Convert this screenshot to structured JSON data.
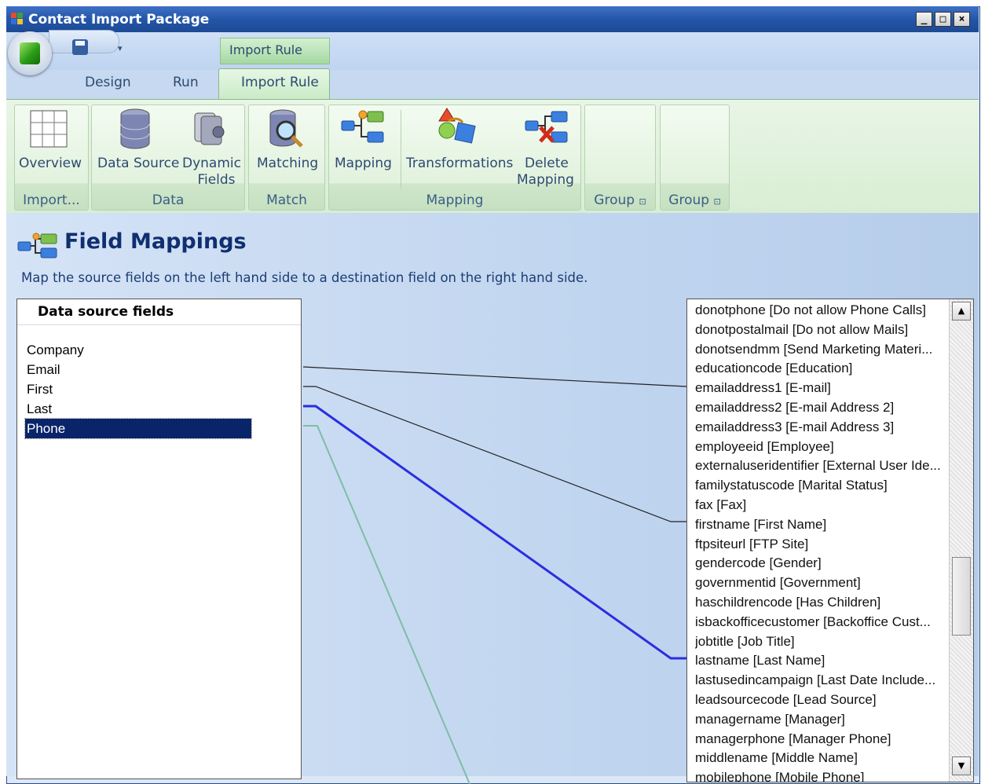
{
  "window": {
    "title": "Contact Import Package",
    "controls": [
      "_",
      "□",
      "×"
    ]
  },
  "ribbon": {
    "context_tab_header": "Import Rule",
    "tabs": [
      "Design",
      "Run",
      "Import Rule"
    ],
    "active_tab": "Import Rule",
    "groups": {
      "import": {
        "label": "Import...",
        "buttons": {
          "overview": "Overview"
        }
      },
      "data": {
        "label": "Data",
        "buttons": {
          "data_source": "Data Source",
          "dynamic_fields_1": "Dynamic",
          "dynamic_fields_2": "Fields"
        }
      },
      "match": {
        "label": "Match",
        "buttons": {
          "matching": "Matching"
        }
      },
      "mapping": {
        "label": "Mapping",
        "buttons": {
          "mapping": "Mapping",
          "transformations": "Transformations",
          "delete_mapping_1": "Delete",
          "delete_mapping_2": "Mapping"
        }
      },
      "group1": {
        "label": "Group"
      },
      "group2": {
        "label": "Group"
      }
    }
  },
  "page": {
    "title": "Field Mappings",
    "description": "Map the source fields on the left hand side to a destination field on the right hand side."
  },
  "source_panel": {
    "header": "Data source fields",
    "fields": [
      "Company",
      "Email",
      "First",
      "Last",
      "Phone"
    ],
    "selected": "Phone"
  },
  "destination_fields": [
    "donotphone [Do not allow Phone Calls]",
    "donotpostalmail [Do not allow Mails]",
    "donotsendmm [Send Marketing Materi...",
    "educationcode [Education]",
    "emailaddress1 [E-mail]",
    "emailaddress2 [E-mail Address 2]",
    "emailaddress3 [E-mail Address 3]",
    "employeeid [Employee]",
    "externaluseridentifier [External User Ide...",
    "familystatuscode [Marital Status]",
    "fax [Fax]",
    "firstname [First Name]",
    "ftpsiteurl [FTP Site]",
    "gendercode [Gender]",
    "governmentid [Government]",
    "haschildrencode [Has Children]",
    "isbackofficecustomer [Backoffice Cust...",
    "jobtitle [Job Title]",
    "lastname [Last Name]",
    "lastusedincampaign [Last Date Include...",
    "leadsourcecode [Lead Source]",
    "managername [Manager]",
    "managerphone [Manager Phone]",
    "middlename [Middle Name]",
    "mobilephone [Mobile Phone]"
  ],
  "mappings": [
    {
      "source": "Email",
      "destination": "emailaddress1 [E-mail]",
      "style": "normal"
    },
    {
      "source": "First",
      "destination": "firstname [First Name]",
      "style": "normal"
    },
    {
      "source": "Last",
      "destination": "lastname [Last Name]",
      "style": "highlighted"
    },
    {
      "source": "Phone",
      "destination": "offscreen",
      "style": "faint"
    }
  ],
  "colors": {
    "highlight_line": "#2a2ee0",
    "normal_line": "#222222",
    "faint_line": "#7fbca6",
    "selection": "#0a246a"
  }
}
